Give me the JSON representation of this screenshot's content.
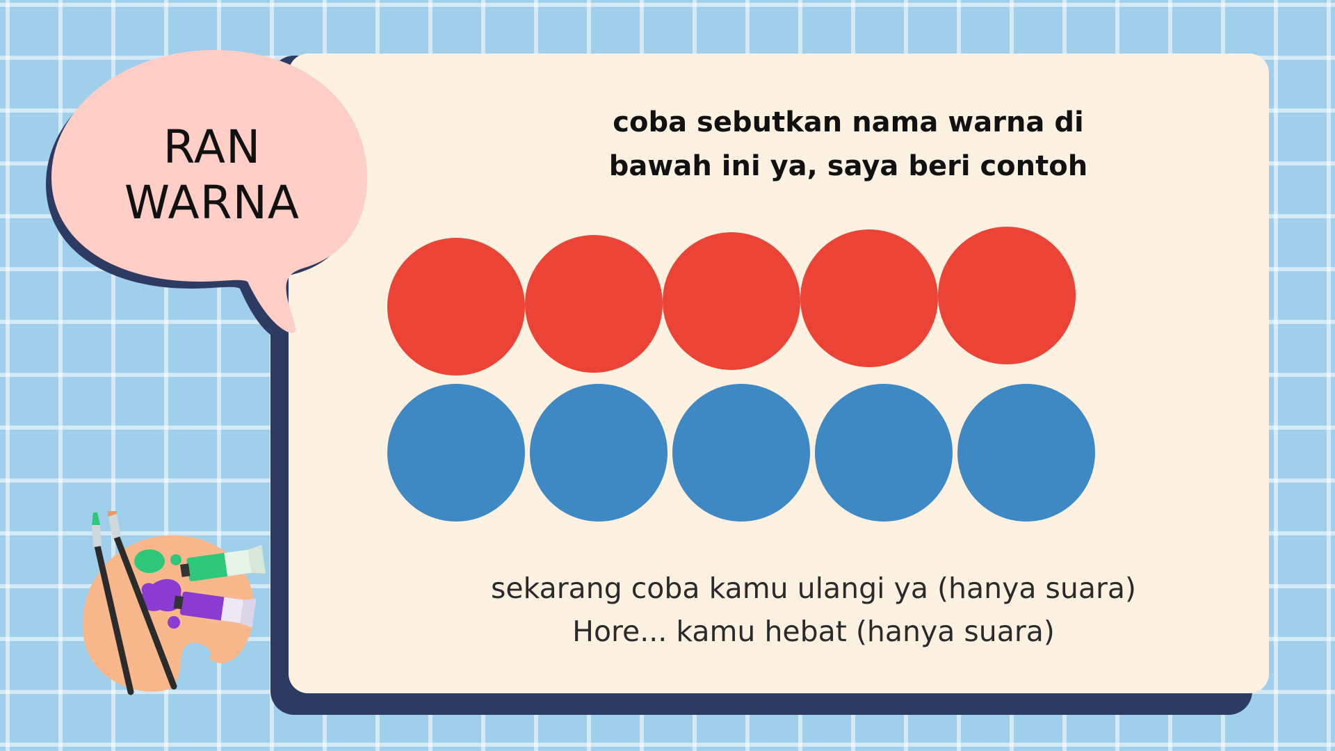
{
  "bubble": {
    "title_line1": "RAN",
    "title_line2": "WARNA"
  },
  "instruction": {
    "line1": "coba sebutkan nama warna di",
    "line2": "bawah ini ya, saya beri contoh"
  },
  "colors": {
    "red": "#eb4436",
    "blue": "#3e88c3",
    "card": "#fdf1e1",
    "card_shadow": "#2d3b63",
    "bubble": "#ffcec6",
    "background": "#9fcfea"
  },
  "circle_rows": [
    {
      "color_name": "red",
      "count": 5
    },
    {
      "color_name": "blue",
      "count": 5
    }
  ],
  "footer": {
    "line1": "sekarang coba kamu ulangi ya (hanya suara)",
    "line2": "Hore... kamu hebat (hanya suara)"
  },
  "decoration": {
    "icon": "paint-palette-icon"
  }
}
